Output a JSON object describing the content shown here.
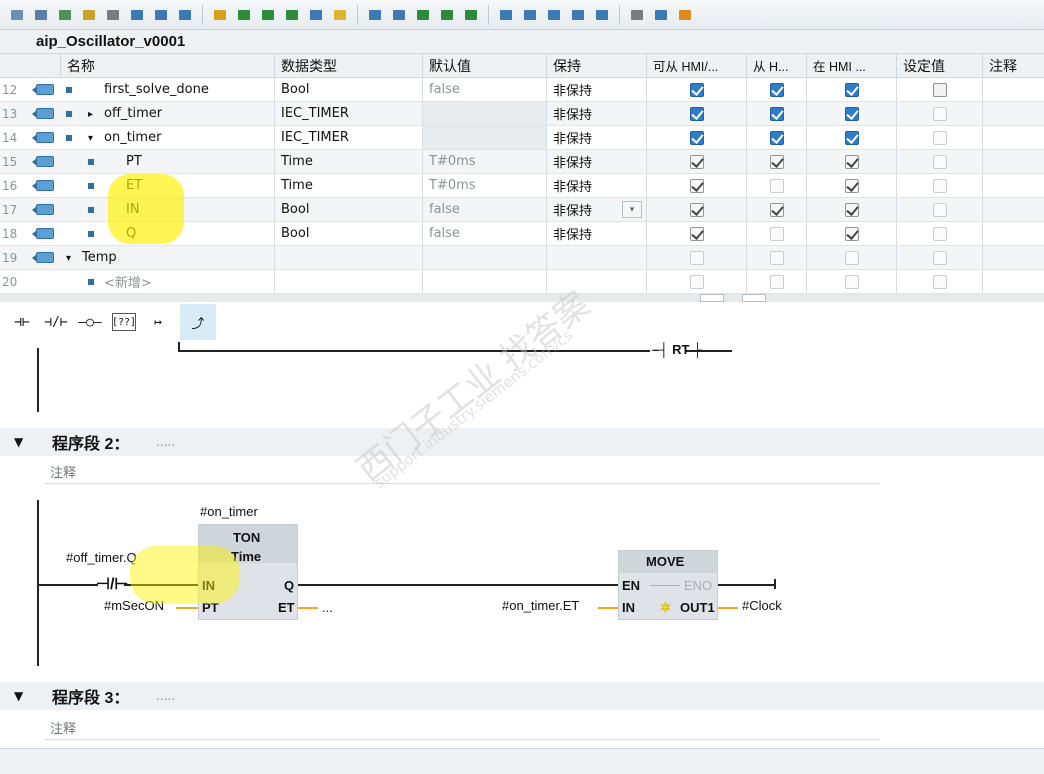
{
  "toolbar": {
    "icons": [
      "insert-row-icon",
      "insert-row-below-icon",
      "add-row-icon",
      "remove-row-icon",
      "monitor-icon",
      "block-outline-icon",
      "block-flat-icon",
      "block-collapse-icon",
      "comment-icon",
      "network-open-icon",
      "network-close-icon",
      "network-all-icon",
      "absolute-address-icon",
      "favorites-icon",
      "go-online-icon",
      "go-offline-icon",
      "download-icon",
      "upload-icon",
      "compile-icon",
      "jump-next-icon",
      "jump-prev-icon",
      "jump-last-icon",
      "break-icon",
      "step-icon",
      "settings-icon",
      "help-icon",
      "db-icon"
    ]
  },
  "block": {
    "title": "aip_Oscillator_v0001"
  },
  "iface": {
    "columns": [
      "名称",
      "数据类型",
      "默认值",
      "保持",
      "可从 HMI/...",
      "从 H...",
      "在 HMI ...",
      "设定值",
      "注释"
    ],
    "rows": [
      {
        "num": "12",
        "name": "first_solve_done",
        "type": "Bool",
        "default": "false",
        "retain": "非保持",
        "c1": "on-strong",
        "c2": "on-strong",
        "c3": "on-strong",
        "c4": "off-strong",
        "expand": "",
        "level": 0
      },
      {
        "num": "13",
        "name": "off_timer",
        "type": "IEC_TIMER",
        "default": "",
        "retain": "非保持",
        "c1": "on-strong",
        "c2": "on-strong",
        "c3": "on-strong",
        "c4": "off-soft",
        "expand": "▸",
        "level": 0
      },
      {
        "num": "14",
        "name": "on_timer",
        "type": "IEC_TIMER",
        "default": "",
        "retain": "非保持",
        "c1": "on-strong",
        "c2": "on-strong",
        "c3": "on-strong",
        "c4": "off-soft",
        "expand": "▾",
        "level": 0
      },
      {
        "num": "15",
        "name": "PT",
        "type": "Time",
        "default": "T#0ms",
        "retain": "非保持",
        "c1": "on-soft",
        "c2": "on-soft",
        "c3": "on-soft",
        "c4": "off-soft",
        "expand": "",
        "level": 1
      },
      {
        "num": "16",
        "name": "ET",
        "type": "Time",
        "default": "T#0ms",
        "retain": "非保持",
        "c1": "on-soft",
        "c2": "off-soft",
        "c3": "on-soft",
        "c4": "off-soft",
        "expand": "",
        "level": 1
      },
      {
        "num": "17",
        "name": "IN",
        "type": "Bool",
        "default": "false",
        "retain": "非保持",
        "c1": "on-soft",
        "c2": "on-soft",
        "c3": "on-soft",
        "c4": "off-soft",
        "expand": "",
        "level": 1
      },
      {
        "num": "18",
        "name": "Q",
        "type": "Bool",
        "default": "false",
        "retain": "非保持",
        "c1": "on-soft",
        "c2": "off-soft",
        "c3": "on-soft",
        "c4": "off-soft",
        "expand": "",
        "level": 1
      },
      {
        "num": "19",
        "name": "Temp",
        "type": "",
        "default": "",
        "retain": "",
        "c1": "off-soft",
        "c2": "off-soft",
        "c3": "off-soft",
        "c4": "off-soft",
        "expand": "▾",
        "level": -1
      },
      {
        "num": "20",
        "name": "<新增>",
        "type": "",
        "default": "",
        "retain": "",
        "c1": "off-soft",
        "c2": "off-soft",
        "c3": "off-soft",
        "c4": "off-soft",
        "expand": "",
        "level": 2
      }
    ]
  },
  "ladbar": {
    "items": [
      "⊣⊢",
      "⊣/⊢",
      "–○–",
      "[??]",
      "↦",
      "⤴"
    ]
  },
  "network1_tail": {
    "coil_label": "RT"
  },
  "network2": {
    "caret": "▼",
    "title": "程序段 2：",
    "dots": ".....",
    "comment": "注释",
    "instance": "#on_timer",
    "ton_name": "TON",
    "ton_type": "Time",
    "contact_operand": "#off_timer.Q",
    "pin_in": "IN",
    "pin_pt": "PT",
    "pin_q": "Q",
    "pin_et": "ET",
    "pt_operand": "#mSecON",
    "et_operand": "...",
    "move_name": "MOVE",
    "move_en": "EN",
    "move_eno": "ENO",
    "move_in": "IN",
    "move_out": "OUT1",
    "move_in_operand": "#on_timer.ET",
    "move_out_operand": "#Clock"
  },
  "network3": {
    "caret": "▼",
    "title": "程序段 3：",
    "dots": ".....",
    "comment": "注释"
  },
  "watermark": {
    "line1": "西门子工业  找答案",
    "line2": "support.industry.siemens.com/cs"
  },
  "colors": {
    "highlight": "#fff200",
    "accent": "#2f7cc8",
    "wire_orange": "#f5a623"
  }
}
